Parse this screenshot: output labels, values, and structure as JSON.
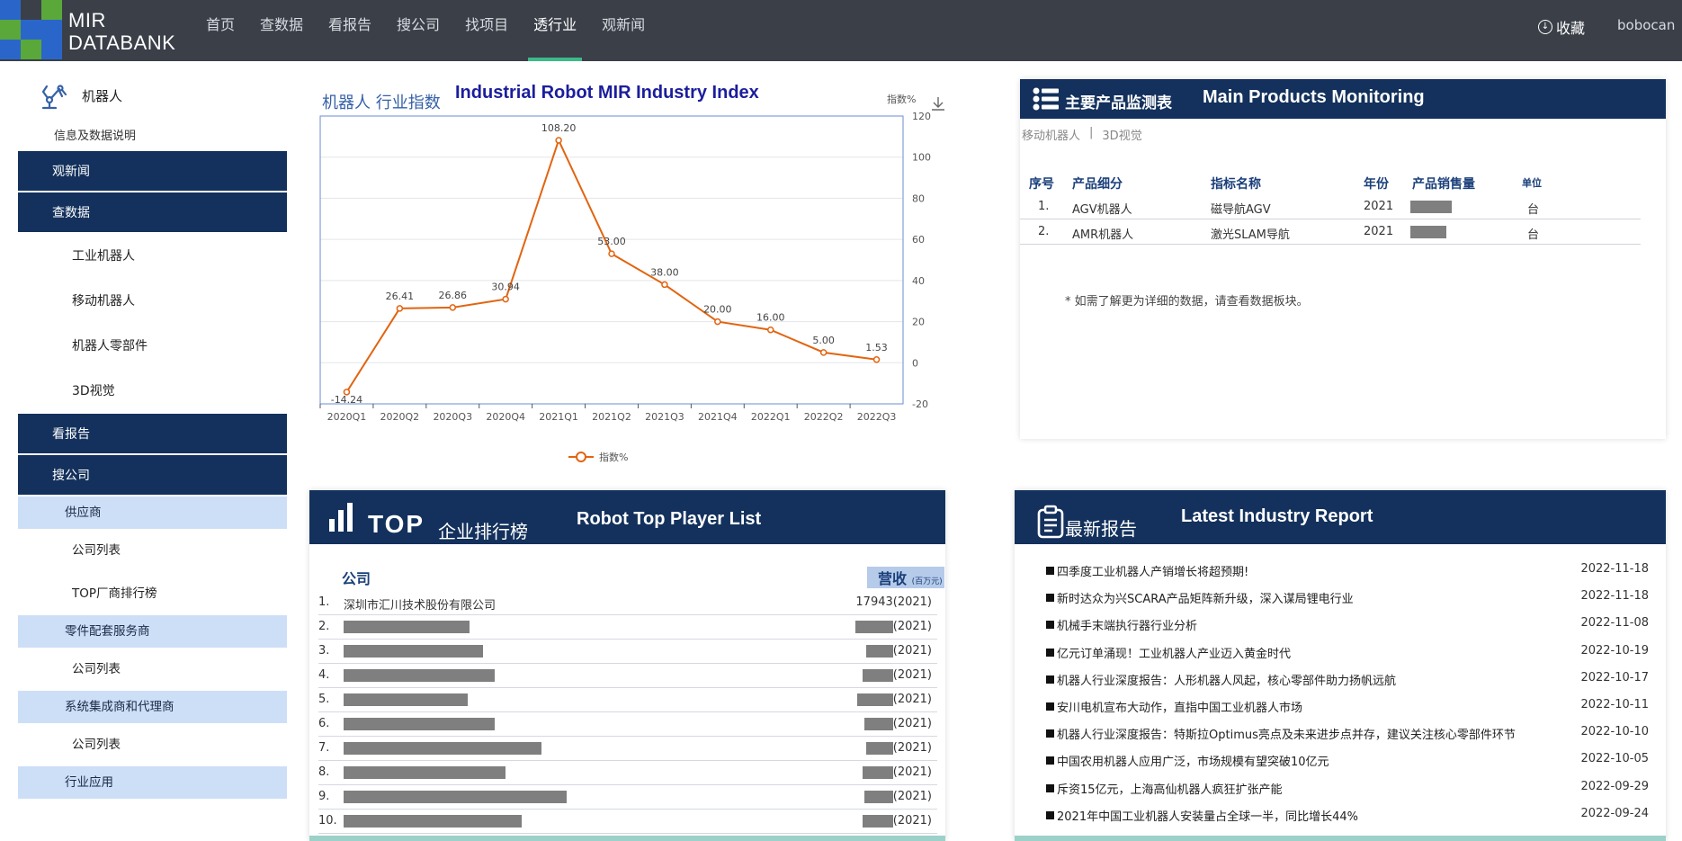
{
  "brand": {
    "line1": "MIR",
    "line2": "DATABANK"
  },
  "nav": [
    {
      "label": "首页",
      "active": false
    },
    {
      "label": "查数据",
      "active": false
    },
    {
      "label": "看报告",
      "active": false
    },
    {
      "label": "搜公司",
      "active": false
    },
    {
      "label": "找项目",
      "active": false
    },
    {
      "label": "透行业",
      "active": true
    },
    {
      "label": "观新闻",
      "active": false
    }
  ],
  "header": {
    "favorite": "收藏",
    "user": "bobocan"
  },
  "sidebar": {
    "title": "机器人",
    "subtitle": "信息及数据说明",
    "items": [
      {
        "label": "观新闻",
        "type": "main"
      },
      {
        "label": "查数据",
        "type": "main"
      },
      {
        "label": "工业机器人",
        "type": "sub"
      },
      {
        "label": "移动机器人",
        "type": "sub"
      },
      {
        "label": "机器人零部件",
        "type": "sub"
      },
      {
        "label": "3D视觉",
        "type": "sub"
      },
      {
        "label": "看报告",
        "type": "main"
      },
      {
        "label": "搜公司",
        "type": "main"
      },
      {
        "label": "供应商",
        "type": "group"
      },
      {
        "label": "公司列表",
        "type": "leaf"
      },
      {
        "label": "TOP厂商排行榜",
        "type": "leaf"
      },
      {
        "label": "零件配套服务商",
        "type": "group"
      },
      {
        "label": "公司列表",
        "type": "leaf"
      },
      {
        "label": "系统集成商和代理商",
        "type": "group"
      },
      {
        "label": "公司列表",
        "type": "leaf"
      },
      {
        "label": "行业应用",
        "type": "group"
      }
    ]
  },
  "index_chart": {
    "title_cn": "机器人 行业指数",
    "title_en": "Industrial Robot MIR Industry Index",
    "unit": "指数%",
    "legend": "指数%"
  },
  "chart_data": {
    "type": "line",
    "categories": [
      "2020Q1",
      "2020Q2",
      "2020Q3",
      "2020Q4",
      "2021Q1",
      "2021Q2",
      "2021Q3",
      "2021Q4",
      "2022Q1",
      "2022Q2",
      "2022Q3"
    ],
    "series": [
      {
        "name": "指数%",
        "values": [
          -14.24,
          26.41,
          26.86,
          30.94,
          108.2,
          53.0,
          38.0,
          20.0,
          16.0,
          5.0,
          1.53
        ],
        "labels": [
          "-14.24",
          "26.41",
          "26.86",
          "30.94",
          "108.20",
          "53.00",
          "38.00",
          "20.00",
          "16.00",
          "5.00",
          "1.53"
        ]
      }
    ],
    "ylim": [
      -20,
      120
    ],
    "yticks": [
      -20,
      0,
      20,
      40,
      60,
      80,
      100,
      120
    ],
    "ylabel": "指数%",
    "y_axis_side": "right",
    "grid": true,
    "legend_position": "bottom",
    "color": "#e26410"
  },
  "products": {
    "title_cn": "主要产品监测表",
    "title_en": "Main Products Monitoring",
    "tabs": [
      "移动机器人",
      "|",
      "3D视觉"
    ],
    "columns": [
      "序号",
      "产品细分",
      "指标名称",
      "年份",
      "产品销售量",
      "单位"
    ],
    "rows": [
      {
        "idx": "1.",
        "product": "AGV机器人",
        "metric": "磁导航AGV",
        "year": "2021",
        "unit": "台"
      },
      {
        "idx": "2.",
        "product": "AMR机器人",
        "metric": "激光SLAM导航",
        "year": "2021",
        "unit": "台"
      }
    ],
    "note": "* 如需了解更为详细的数据，请查看数据板块。"
  },
  "top_players": {
    "title_big": "TOP",
    "title_cn": "企业排行榜",
    "title_en": "Robot Top Player List",
    "col_company": "公司",
    "col_revenue": "营收",
    "col_revenue_unit": "(百万元)",
    "rows": [
      {
        "num": "1.",
        "name": "深圳市汇川技术股份有限公司",
        "revenue": "17943(2021)"
      },
      {
        "num": "2.",
        "name": "",
        "revenue": "(2021)"
      },
      {
        "num": "3.",
        "name": "",
        "revenue": "(2021)"
      },
      {
        "num": "4.",
        "name": "",
        "revenue": "(2021)"
      },
      {
        "num": "5.",
        "name": "",
        "revenue": "(2021)"
      },
      {
        "num": "6.",
        "name": "",
        "revenue": "(2021)"
      },
      {
        "num": "7.",
        "name": "",
        "revenue": "(2021)"
      },
      {
        "num": "8.",
        "name": "",
        "revenue": "(2021)"
      },
      {
        "num": "9.",
        "name": "",
        "revenue": "(2021)"
      },
      {
        "num": "10.",
        "name": "",
        "revenue": "(2021)"
      }
    ]
  },
  "reports": {
    "title_cn": "最新报告",
    "title_en": "Latest Industry Report",
    "items": [
      {
        "title": "四季度工业机器人产销增长将超预期!",
        "date": "2022-11-18"
      },
      {
        "title": "新时达众为兴SCARA产品矩阵新升级，深入谋局锂电行业",
        "date": "2022-11-18"
      },
      {
        "title": "机械手末端执行器行业分析",
        "date": "2022-11-08"
      },
      {
        "title": "亿元订单涌现！工业机器人产业迈入黄金时代",
        "date": "2022-10-19"
      },
      {
        "title": "机器人行业深度报告：人形机器人风起，核心零部件助力扬帆远航",
        "date": "2022-10-17"
      },
      {
        "title": "安川电机宣布大动作，直指中国工业机器人市场",
        "date": "2022-10-11"
      },
      {
        "title": "机器人行业深度报告：特斯拉Optimus亮点及未来进步点并存，建议关注核心零部件环节",
        "date": "2022-10-10"
      },
      {
        "title": "中国农用机器人应用广泛，市场规模有望突破10亿元",
        "date": "2022-10-05"
      },
      {
        "title": "斥资15亿元，上海高仙机器人疯狂扩张产能",
        "date": "2022-09-29"
      },
      {
        "title": "2021年中国工业机器人安装量占全球一半，同比增长44%",
        "date": "2022-09-24"
      }
    ]
  }
}
